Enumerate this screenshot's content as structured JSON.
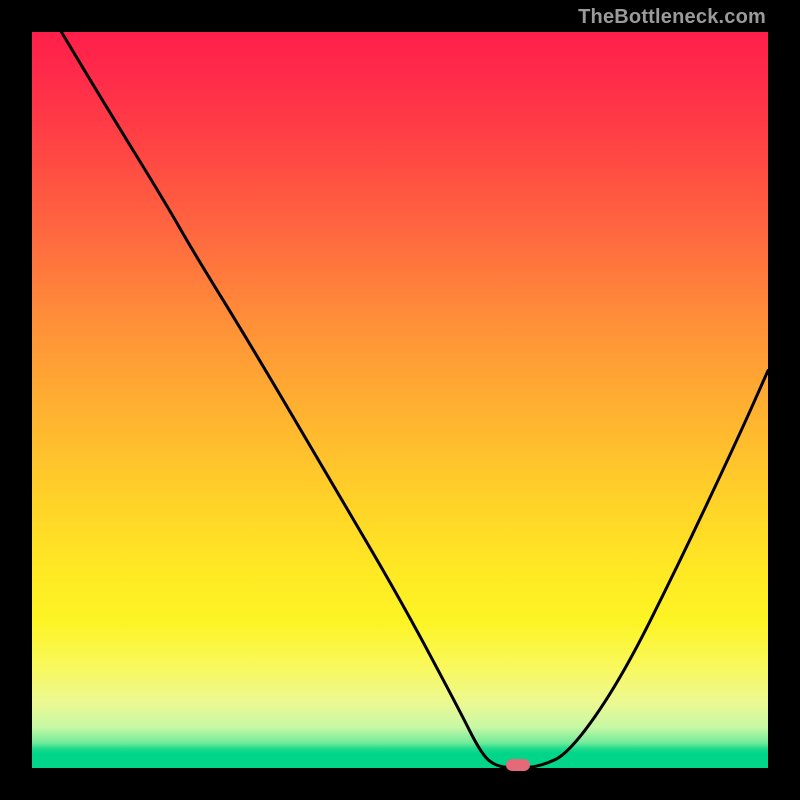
{
  "watermark": "TheBottleneck.com",
  "colors": {
    "page_bg": "#000000",
    "curve_stroke": "#000000",
    "marker_fill": "#e46a77",
    "watermark_text": "#9a9a9a"
  },
  "chart_data": {
    "type": "line",
    "title": "",
    "xlabel": "",
    "ylabel": "",
    "xlim": [
      0,
      100
    ],
    "ylim": [
      0,
      100
    ],
    "grid": false,
    "legend": false,
    "series": [
      {
        "name": "bottleneck-curve",
        "x": [
          4,
          10,
          18,
          22,
          30,
          40,
          50,
          58,
          61,
          63,
          66,
          69,
          73,
          80,
          88,
          96,
          100
        ],
        "values": [
          100,
          90,
          77,
          70,
          57,
          40,
          23,
          8,
          2,
          0.2,
          0,
          0.2,
          2,
          12,
          28,
          45,
          54
        ]
      }
    ],
    "marker": {
      "x": 66,
      "y": 0
    },
    "gradient_stops": [
      {
        "pct": 0,
        "color": "#ff1f4a"
      },
      {
        "pct": 15,
        "color": "#ff4244"
      },
      {
        "pct": 40,
        "color": "#ff9138"
      },
      {
        "pct": 64,
        "color": "#ffd328"
      },
      {
        "pct": 80,
        "color": "#fdf424"
      },
      {
        "pct": 94,
        "color": "#c7f8a5"
      },
      {
        "pct": 98,
        "color": "#00d58a"
      },
      {
        "pct": 100,
        "color": "#00d58a"
      }
    ]
  }
}
